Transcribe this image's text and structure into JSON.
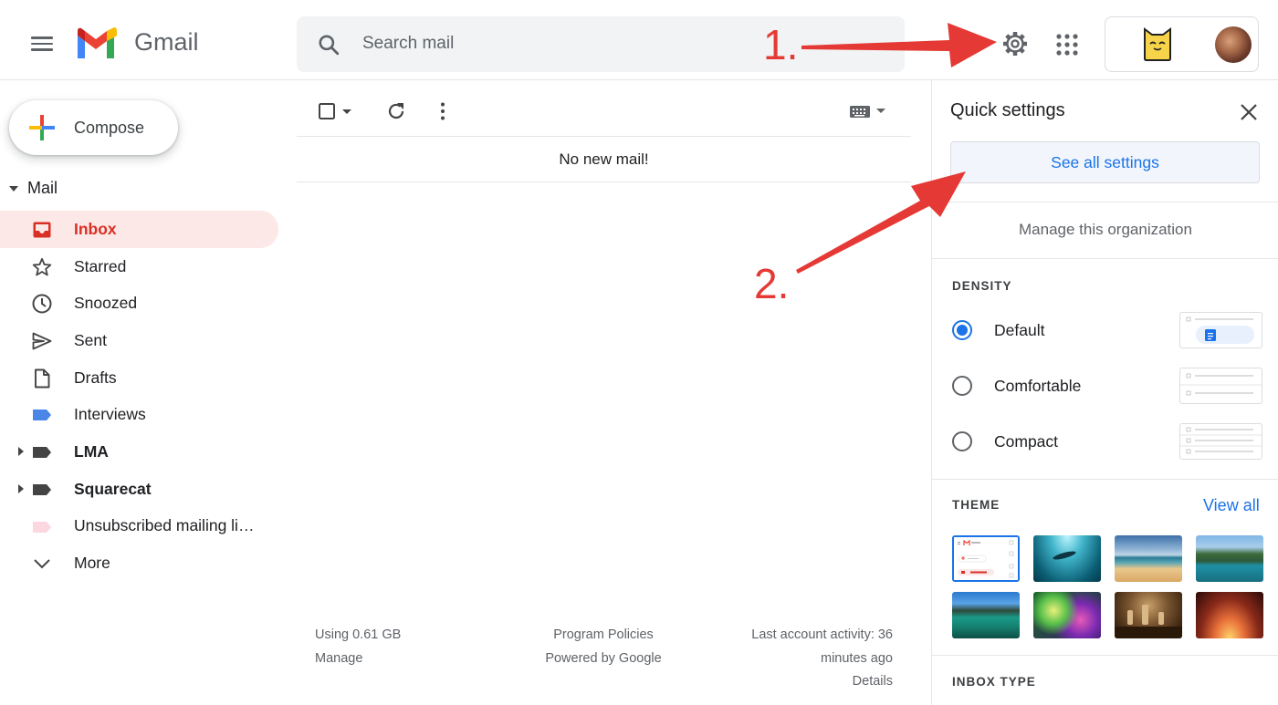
{
  "header": {
    "app_name": "Gmail",
    "search_placeholder": "Search mail",
    "icons": [
      "menu-icon",
      "gmail-logo",
      "search-icon",
      "settings-gear-icon",
      "apps-grid-icon",
      "squarecat-logo",
      "user-avatar"
    ]
  },
  "annotations": {
    "step1": "1.",
    "step2": "2.",
    "color": "#e53935"
  },
  "sidebar": {
    "compose_label": "Compose",
    "mail_label": "Mail",
    "items": [
      {
        "label": "Inbox",
        "icon": "inbox-icon",
        "active": true
      },
      {
        "label": "Starred",
        "icon": "star-icon"
      },
      {
        "label": "Snoozed",
        "icon": "clock-icon"
      },
      {
        "label": "Sent",
        "icon": "send-icon"
      },
      {
        "label": "Drafts",
        "icon": "draft-icon"
      },
      {
        "label": "Interviews",
        "icon": "label-icon",
        "color": "#4a86e8"
      },
      {
        "label": "LMA",
        "icon": "label-icon",
        "color": "#444444"
      },
      {
        "label": "Squarecat",
        "icon": "label-icon",
        "color": "#444444"
      },
      {
        "label": "Unsubscribed mailing li…",
        "icon": "label-icon",
        "color": "#fbd8e0"
      },
      {
        "label": "More",
        "icon": "chevron-down-icon"
      }
    ]
  },
  "main": {
    "empty_message": "No new mail!",
    "footer": {
      "storage_line1": "Using 0.61 GB",
      "storage_line2": "Manage",
      "policies_line1": "Program Policies",
      "policies_line2": "Powered by Google",
      "activity_line1": "Last account activity: 36",
      "activity_line2": "minutes ago",
      "activity_line3": "Details"
    }
  },
  "quick_settings": {
    "title": "Quick settings",
    "see_all": "See all settings",
    "manage_org": "Manage this organization",
    "density_title": "DENSITY",
    "density_options": [
      {
        "label": "Default",
        "selected": true
      },
      {
        "label": "Comfortable",
        "selected": false
      },
      {
        "label": "Compact",
        "selected": false
      }
    ],
    "theme_title": "THEME",
    "view_all": "View all",
    "inbox_type_title": "INBOX TYPE",
    "accent_color": "#1a73e8"
  }
}
